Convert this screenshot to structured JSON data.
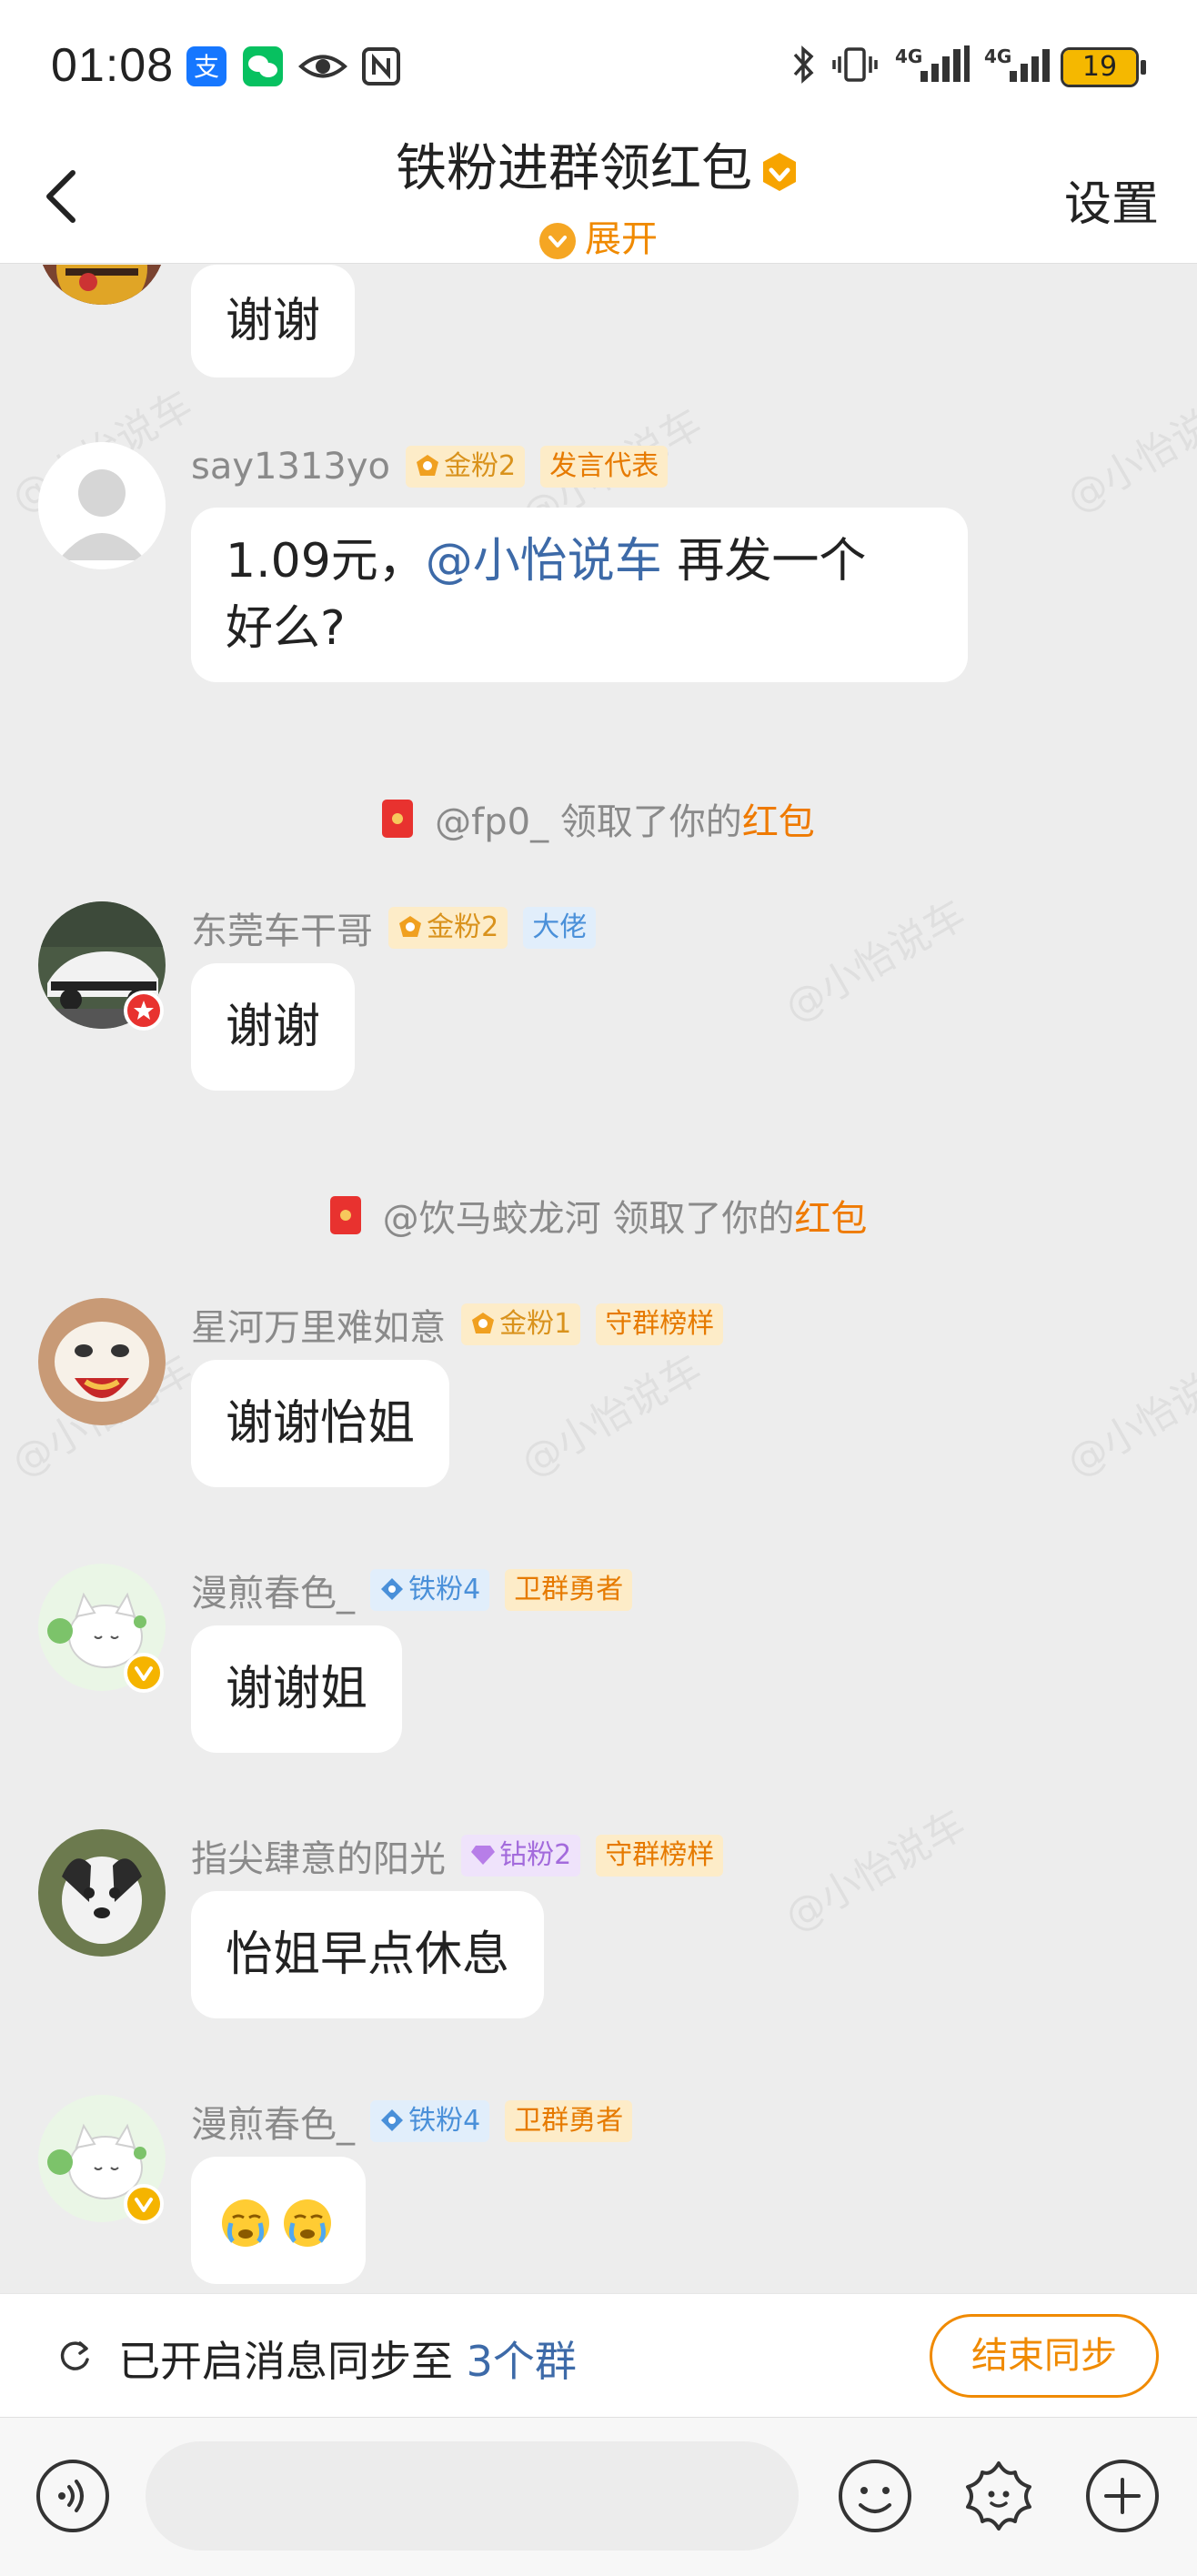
{
  "status_bar": {
    "time": "01:08",
    "battery": "19",
    "network_1": "4G",
    "network_2": "4G",
    "icons": [
      "alipay-icon",
      "wechat-icon",
      "eye-icon",
      "nfc-icon",
      "bluetooth-icon",
      "vibrate-icon",
      "signal-icon",
      "battery-icon"
    ]
  },
  "header": {
    "title": "铁粉进群领红包",
    "expand_label": "展开",
    "settings_label": "设置"
  },
  "watermark": "@小怡说车",
  "messages": [
    {
      "username": "",
      "text": "谢谢"
    },
    {
      "username": "say1313yo",
      "tags": [
        {
          "label": "金粉2",
          "style": "gold"
        },
        {
          "label": "发言代表",
          "style": "orange"
        }
      ],
      "text_before": "1.09元，",
      "mention": "@小怡说车",
      "text_after": " 再发一个",
      "text_line2": "好么?"
    },
    {
      "username": "东莞车干哥",
      "tags": [
        {
          "label": "金粉2",
          "style": "gold"
        },
        {
          "label": "大佬",
          "style": "blue"
        }
      ],
      "text": "谢谢"
    },
    {
      "username": "星河万里难如意",
      "tags": [
        {
          "label": "金粉1",
          "style": "gold"
        },
        {
          "label": "守群榜样",
          "style": "orange"
        }
      ],
      "text": "谢谢怡姐"
    },
    {
      "username": "漫煎春色_",
      "tags": [
        {
          "label": "铁粉4",
          "style": "blue"
        },
        {
          "label": "卫群勇者",
          "style": "orange"
        }
      ],
      "text": "谢谢姐"
    },
    {
      "username": "指尖肆意的阳光",
      "tags": [
        {
          "label": "钻粉2",
          "style": "purple"
        },
        {
          "label": "守群榜样",
          "style": "orange"
        }
      ],
      "text": "怡姐早点休息"
    },
    {
      "username": "漫煎春色_",
      "tags": [
        {
          "label": "铁粉4",
          "style": "blue"
        },
        {
          "label": "卫群勇者",
          "style": "orange"
        }
      ],
      "text": "😭😭"
    }
  ],
  "system_messages": [
    {
      "user": "@fp0_",
      "action": " 领取了你的",
      "item": "红包"
    },
    {
      "user": "@饮马蛟龙河",
      "action": " 领取了你的",
      "item": "红包"
    }
  ],
  "sync_bar": {
    "text": "已开启消息同步至 ",
    "count": "3个群",
    "end_button": "结束同步"
  },
  "input_bar": {
    "placeholder": "",
    "icons": [
      "voice-icon",
      "emoji-icon",
      "sticker-icon",
      "plus-icon"
    ]
  },
  "colors": {
    "accent": "#f08a00",
    "mention": "#3d6aa8",
    "background": "#ededed",
    "red_packet": "#e8322f"
  }
}
